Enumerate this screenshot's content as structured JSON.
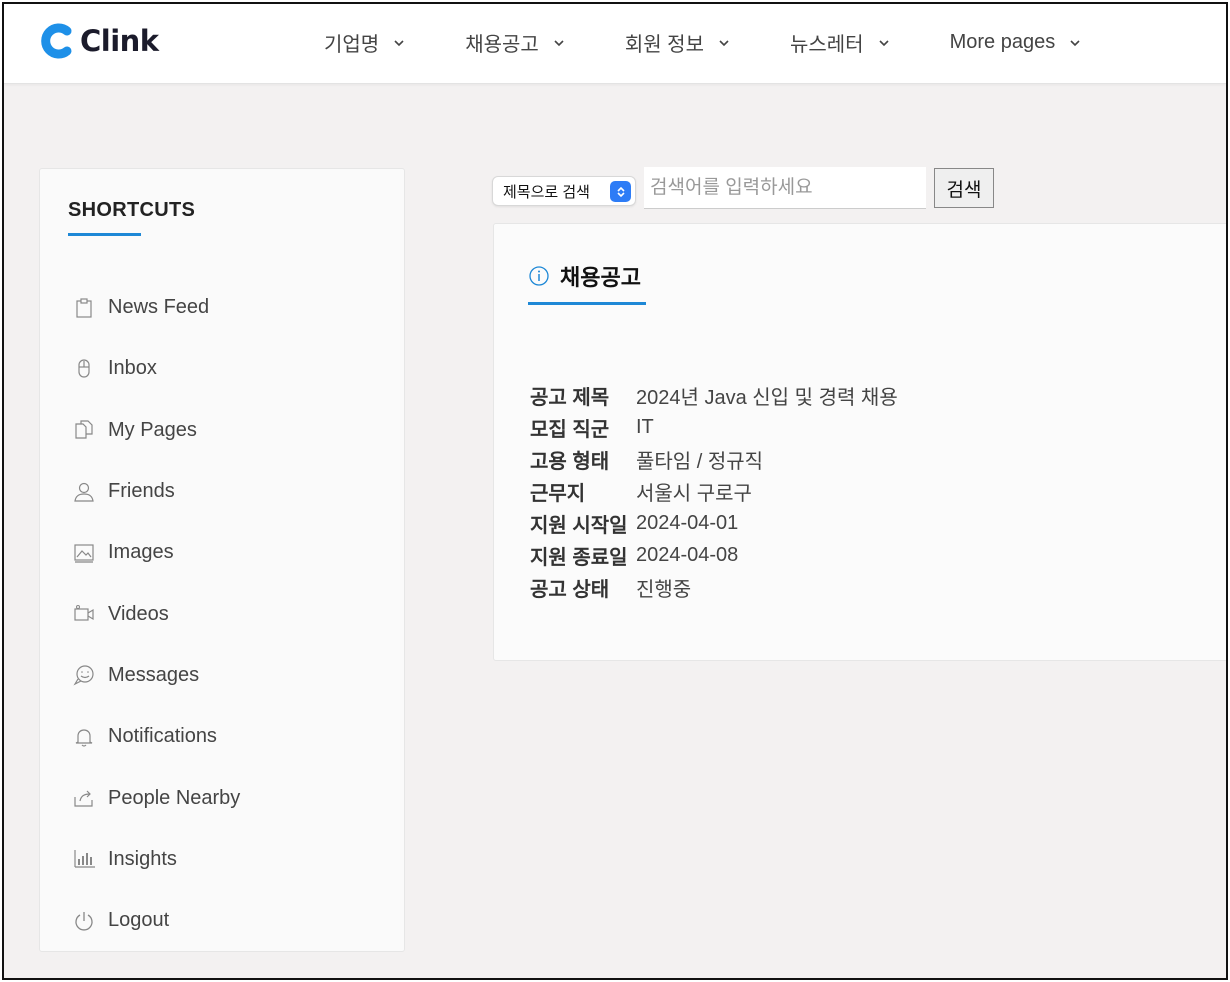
{
  "header": {
    "logo_text": "Clink",
    "nav": [
      {
        "label": "기업명"
      },
      {
        "label": "채용공고"
      },
      {
        "label": "회원 정보"
      },
      {
        "label": "뉴스레터"
      },
      {
        "label": "More pages"
      }
    ]
  },
  "sidebar": {
    "title": "SHORTCUTS",
    "items": [
      {
        "label": "News Feed",
        "icon": "clipboard-icon"
      },
      {
        "label": "Inbox",
        "icon": "mouse-icon"
      },
      {
        "label": "My Pages",
        "icon": "copy-icon"
      },
      {
        "label": "Friends",
        "icon": "user-icon"
      },
      {
        "label": "Images",
        "icon": "image-icon"
      },
      {
        "label": "Videos",
        "icon": "video-icon"
      },
      {
        "label": "Messages",
        "icon": "chat-icon"
      },
      {
        "label": "Notifications",
        "icon": "bell-icon"
      },
      {
        "label": "People Nearby",
        "icon": "share-icon"
      },
      {
        "label": "Insights",
        "icon": "bar-chart-icon"
      },
      {
        "label": "Logout",
        "icon": "power-icon"
      }
    ]
  },
  "search": {
    "select_value": "제목으로 검색",
    "placeholder": "검색어를 입력하세요",
    "button_label": "검색"
  },
  "card": {
    "title": "채용공고",
    "rows": [
      {
        "key": "공고 제목",
        "value": "2024년 Java 신입 및 경력 채용"
      },
      {
        "key": "모집 직군",
        "value": "IT"
      },
      {
        "key": "고용 형태",
        "value": "풀타임 / 정규직"
      },
      {
        "key": "근무지",
        "value": "서울시 구로구"
      },
      {
        "key": "지원 시작일",
        "value": "2024-04-01"
      },
      {
        "key": "지원 종료일",
        "value": "2024-04-08"
      },
      {
        "key": "공고 상태",
        "value": "진행중"
      }
    ]
  },
  "colors": {
    "accent": "#1e88d6",
    "page_background": "#f3f1f1",
    "select_button": "#2d7cf6"
  }
}
